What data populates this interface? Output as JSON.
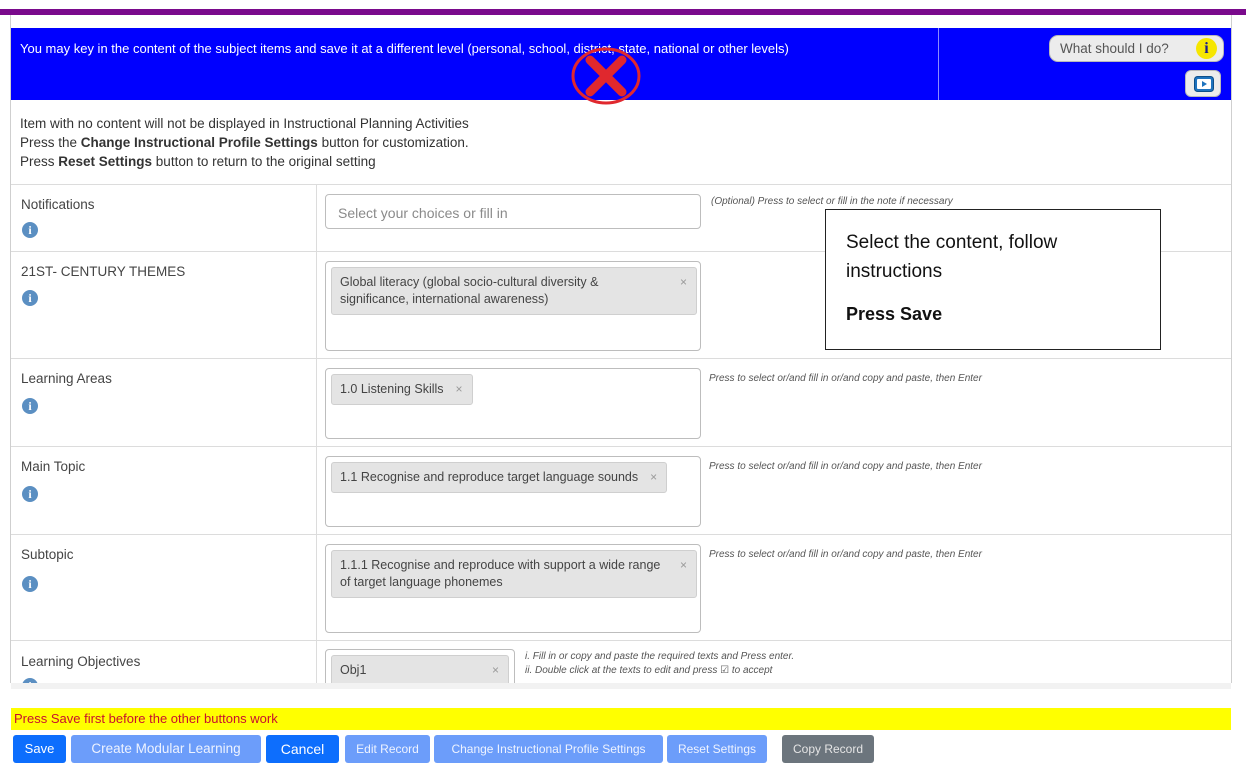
{
  "colors": {
    "banner_bg": "#0000ff",
    "accent_rule": "#7a0a8c",
    "notice_bg": "#ffff00",
    "notice_text": "#c8102e",
    "primary_button": "#0d6efd",
    "info_icon": "#5b8fc2"
  },
  "banner": {
    "text": "You may key in the content of the subject items and save it at a different level (personal, school, district, state, national or other levels)",
    "help_label": "What should I do?",
    "help_icon": "info-i-icon",
    "video_icon": "video-play-icon",
    "reject_mark_icon": "red-x-circle-icon"
  },
  "instructions": {
    "line1": "Item with no content will not be displayed in Instructional Planning Activities",
    "line2_prefix": "Press the ",
    "line2_bold": "Change Instructional Profile Settings",
    "line2_suffix": " button for customization.",
    "line3_prefix": "Press ",
    "line3_bold": "Reset Settings",
    "line3_suffix": " button to return to the original setting"
  },
  "rows": {
    "notifications": {
      "label": "Notifications",
      "placeholder": "Select your choices or fill in",
      "hint": "(Optional) Press to select or fill in the note if necessary"
    },
    "themes": {
      "label": "21ST- CENTURY THEMES",
      "chip": "Global literacy (global socio-cultural diversity & significance, international awareness)"
    },
    "learning_areas": {
      "label": "Learning Areas",
      "chip": "1.0 Listening Skills",
      "hint": "Press to select or/and fill in or/and copy and paste, then Enter"
    },
    "main_topic": {
      "label": "Main Topic",
      "chip": "1.1 Recognise and reproduce target language sounds",
      "hint": "Press to select or/and fill in or/and copy and paste, then Enter"
    },
    "subtopic": {
      "label": "Subtopic",
      "chip": "1.1.1 Recognise and reproduce with support a wide range of target language phonemes",
      "hint": "Press to select or/and fill in or/and copy and paste, then Enter"
    },
    "objectives": {
      "label": "Learning Objectives",
      "chip": "Obj1",
      "hint1": "i. Fill in or copy and paste the required texts and Press enter.",
      "hint2": "ii. Double click at the texts to edit and press ☑ to accept"
    }
  },
  "chip_remove": "×",
  "info_glyph": "i",
  "callout": {
    "text": "Select the content, follow instructions",
    "action": "Press Save"
  },
  "notice": "Press Save first before the other buttons work",
  "buttons": {
    "save": "Save",
    "create_modular": "Create Modular Learning",
    "cancel": "Cancel",
    "edit_record": "Edit Record",
    "change_profile": "Change Instructional Profile Settings",
    "reset": "Reset Settings",
    "copy_record": "Copy Record"
  }
}
